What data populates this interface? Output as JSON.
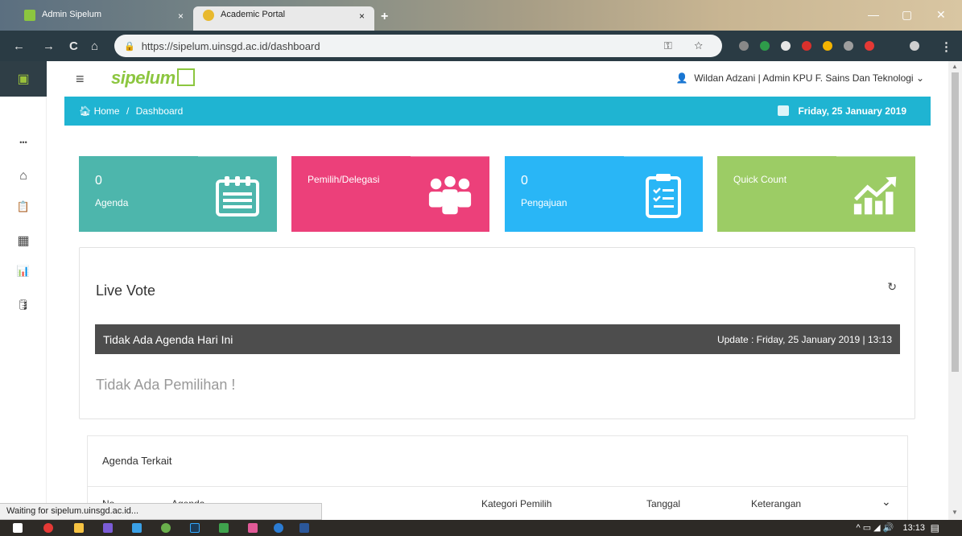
{
  "browser": {
    "tabs": [
      {
        "title": "Admin Sipelum",
        "active": false
      },
      {
        "title": "Academic Portal",
        "active": true
      }
    ],
    "new_tab_symbol": "+",
    "tab_close_symbol": "×",
    "url": "https://sipelum.uinsgd.ac.id/dashboard",
    "nav": {
      "back": "←",
      "forward": "→",
      "reload": "C",
      "home": "⌂"
    },
    "omnibox_icons": "⚿ ☆"
  },
  "app": {
    "logo_text": "sipelum",
    "user_text": "Wildan Adzani | Admin KPU F. Sains Dan Teknologi",
    "user_caret": "⌄",
    "rail_items": [
      {
        "icon": "more-dots-icon",
        "glyph": "•••"
      },
      {
        "icon": "home-icon",
        "glyph": "⌂"
      },
      {
        "icon": "clipboard-icon",
        "glyph": "📋"
      },
      {
        "icon": "calendar-icon",
        "glyph": "▦"
      },
      {
        "icon": "bar-chart-icon",
        "glyph": "📊"
      },
      {
        "icon": "database-icon",
        "glyph": "🛢"
      }
    ]
  },
  "breadcrumb": {
    "home": "Home",
    "separator": "/",
    "current": "Dashboard",
    "date": "Friday, 25 January 2019"
  },
  "cards": [
    {
      "number": "0",
      "label": "Agenda",
      "color": "#4db6ac",
      "icon": "calendar-icon"
    },
    {
      "number": "",
      "label": "Pemilih/Delegasi",
      "color": "#ec407a",
      "icon": "users-icon"
    },
    {
      "number": "0",
      "label": "Pengajuan",
      "color": "#29b6f6",
      "icon": "clipboard-list-icon"
    },
    {
      "number": "",
      "label": "Quick Count",
      "color": "#9ccc65",
      "icon": "trending-up-icon"
    }
  ],
  "live_vote": {
    "title": "Live Vote",
    "bar_left": "Tidak Ada Agenda Hari Ini",
    "bar_right": "Update : Friday, 25 January 2019 | 13:13",
    "empty_message": "Tidak Ada Pemilihan !",
    "refresh_glyph": "↻"
  },
  "agenda": {
    "title": "Agenda Terkait",
    "columns": [
      "No",
      "Agenda",
      "Kategori Pemilih",
      "Tanggal",
      "Keterangan"
    ],
    "expand_glyph": "⌄"
  },
  "status_bar": "Waiting for sipelum.uinsgd.ac.id...",
  "taskbar": {
    "time": "13:13",
    "tray": "^ ▭ ◢ 🔊",
    "notif_glyph": "▤"
  },
  "colors": {
    "breadcrumb_bg": "#1fb4d2",
    "dark_bar": "#4d4d4d",
    "logo_green": "#8cc63f"
  }
}
